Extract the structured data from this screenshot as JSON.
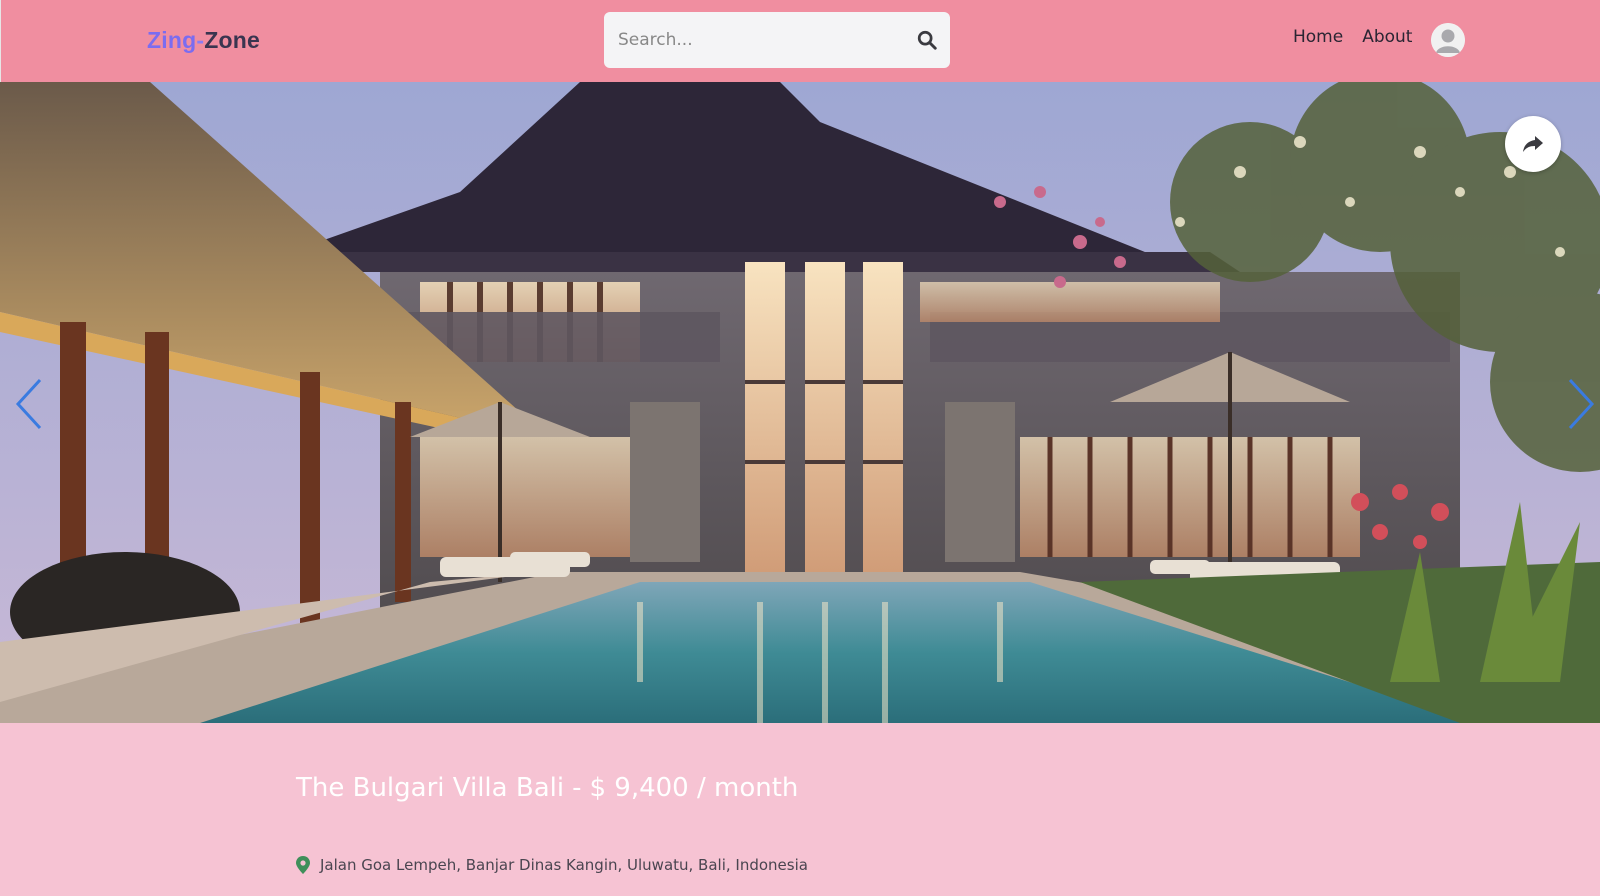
{
  "brand": {
    "part1": "Zing",
    "dash": "-",
    "part2": "Zone",
    "color_primary": "#7b6cf0",
    "color_dark": "#3a3550"
  },
  "search": {
    "placeholder": "Search...",
    "value": "",
    "icon": "search-icon"
  },
  "nav": {
    "items": [
      {
        "label": "Home"
      },
      {
        "label": "About"
      }
    ],
    "avatar_icon": "user-avatar-icon"
  },
  "hero": {
    "share_icon": "share-icon",
    "prev_icon": "chevron-left-icon",
    "next_icon": "chevron-right-icon"
  },
  "listing": {
    "name": "The Bulgari Villa Bali",
    "separator": "-",
    "price": "$ 9,400 / month",
    "address": "Jalan Goa Lempeh, Banjar Dinas Kangin, Uluwatu, Bali, Indonesia",
    "pin_icon": "location-pin-icon"
  },
  "colors": {
    "header_bg": "#f08ea0",
    "page_bg": "#f6c3d3",
    "arrow": "#3a7be0",
    "pin": "#3f8f5a"
  }
}
